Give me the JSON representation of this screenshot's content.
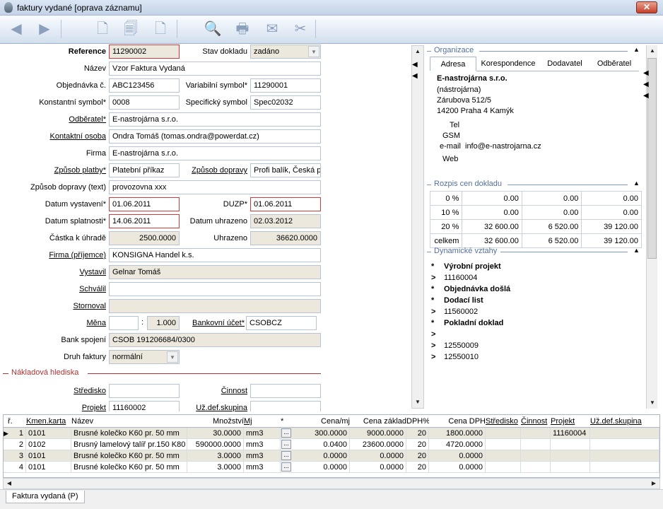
{
  "window": {
    "title": "faktury vydané [oprava záznamu]",
    "close_label": "✕"
  },
  "form": {
    "reference_label": "Reference",
    "reference_value": "11290002",
    "stav_label": "Stav dokladu",
    "stav_value": "zadáno",
    "nazev_label": "Název",
    "nazev_value": "Vzor Faktura Vydaná",
    "objednavka_label": "Objednávka č.",
    "objednavka_value": "ABC123456",
    "varsym_label": "Variabilní symbol*",
    "varsym_value": "11290001",
    "konstsym_label": "Konstantní symbol*",
    "konstsym_value": "0008",
    "specsym_label": "Specifický symbol",
    "specsym_value": "Spec02032",
    "odberatel_label": "Odběratel*",
    "odberatel_value": "E-nastrojárna s.r.o.",
    "kontakt_label": "Kontaktní osoba",
    "kontakt_value": "Ondra Tomáš (tomas.ondra@powerdat.cz)",
    "firma_label": "Firma",
    "firma_value": "E-nastrojárna s.r.o.",
    "platba_label": "Způsob platby*",
    "platba_value": "Platební příkaz",
    "doprava_label": "Způsob dopravy",
    "doprava_value": "Profi balík, Česká p",
    "dopravatext_label": "Způsob dopravy (text)",
    "dopravatext_value": "provozovna  xxx",
    "datvyst_label": "Datum vystavení*",
    "datvyst_value": "01.06.2011",
    "duzp_label": "DUZP*",
    "duzp_value": "01.06.2011",
    "datspl_label": "Datum splatnosti*",
    "datspl_value": "14.06.2011",
    "datuhr_label": "Datum uhrazeno",
    "datuhr_value": "02.03.2012",
    "castka_label": "Částka k úhradě",
    "castka_value": "2500.0000",
    "uhrazeno_label": "Uhrazeno",
    "uhrazeno_value": "36620.0000",
    "firmaprij_label": "Firma (příjemce)",
    "firmaprij_value": "KONSIGNA Handel k.s.",
    "vystavil_label": "Vystavil",
    "vystavil_value": "Gelnar Tomáš",
    "schvalil_label": "Schválil",
    "schvalil_value": "",
    "stornoval_label": "Stornoval",
    "stornoval_value": "",
    "mena_label": "Měna",
    "mena_value": "",
    "kurz_sep": ":",
    "kurz_value": "1.000",
    "ucet_label": "Bankovní účet*",
    "ucet_value": "CSOBCZ",
    "bankspoj_label": "Bank spojení",
    "bankspoj_value": "CSOB 191206684/0300",
    "druh_label": "Druh faktury",
    "druh_value": "normální",
    "nakl_section": "Nákladová hlediska",
    "stredisko_label": "Středisko",
    "stredisko_value": "",
    "cinnost_label": "Činnost",
    "cinnost_value": "",
    "projekt_label": "Projekt",
    "projekt_value": "11160002",
    "uzdef_label": "Už.def.skupina",
    "uzdef_value": ""
  },
  "org": {
    "section": "Organizace",
    "tabs": [
      "Adresa",
      "Korespondence",
      "Dodavatel",
      "Odběratel"
    ],
    "name": "E-nastrojárna s.r.o.",
    "short": "(nástrojárna)",
    "street": "Zárubova 512/5",
    "city": "14200 Praha 4 Kamýk",
    "tel_label": "Tel",
    "gsm_label": "GSM",
    "email_label": "e-mail",
    "email_value": "info@e-nastrojarna.cz",
    "web_label": "Web"
  },
  "prices": {
    "section": "Rozpis cen dokladu",
    "rows": [
      [
        "0 %",
        "0.00",
        "0.00",
        "0.00"
      ],
      [
        "10 %",
        "0.00",
        "0.00",
        "0.00"
      ],
      [
        "20 %",
        "32 600.00",
        "6 520.00",
        "39 120.00"
      ],
      [
        "celkem",
        "32 600.00",
        "6 520.00",
        "39 120.00"
      ]
    ]
  },
  "relations": {
    "section": "Dynamické vztahy",
    "items": [
      {
        "mark": "*",
        "text": "Výrobní projekt",
        "bold": true
      },
      {
        "mark": ">",
        "text": "11160004",
        "bold": false
      },
      {
        "mark": "*",
        "text": "Objednávka došlá",
        "bold": true
      },
      {
        "mark": "*",
        "text": "Dodací list",
        "bold": true
      },
      {
        "mark": ">",
        "text": "11560002",
        "bold": false
      },
      {
        "mark": "*",
        "text": "Pokladní doklad",
        "bold": true
      },
      {
        "mark": ">",
        "text": "",
        "bold": false
      },
      {
        "mark": ">",
        "text": "12550009",
        "bold": false
      },
      {
        "mark": ">",
        "text": "12550010",
        "bold": false
      }
    ]
  },
  "grid": {
    "headers": [
      "ř.",
      "Kmen.karta",
      "Název",
      "Množství",
      "Mj",
      "*",
      "Cena/mj",
      "Cena základ",
      "DPH%",
      "Cena DPH",
      "Středisko",
      "Činnost",
      "Projekt",
      "Už.def.skupina"
    ],
    "rows": [
      [
        "1",
        "0101",
        "Brusné kolečko K60 pr. 50 mm",
        "30.0000",
        "mm3",
        "...",
        "300.0000",
        "9000.0000",
        "20",
        "1800.0000",
        "",
        "",
        "11160004",
        ""
      ],
      [
        "2",
        "0102",
        "Brusný lamelový talíř pr.150  K80",
        "590000.0000",
        "mm3",
        "...",
        "0.0400",
        "23600.0000",
        "20",
        "4720.0000",
        "",
        "",
        "",
        ""
      ],
      [
        "3",
        "0101",
        "Brusné kolečko K60 pr. 50 mm",
        "3.0000",
        "mm3",
        "...",
        "0.0000",
        "0.0000",
        "20",
        "0.0000",
        "",
        "",
        "",
        ""
      ],
      [
        "4",
        "0101",
        "Brusné kolečko K60 pr. 50 mm",
        "3.0000",
        "mm3",
        "...",
        "0.0000",
        "0.0000",
        "20",
        "0.0000",
        "",
        "",
        "",
        ""
      ]
    ]
  },
  "status": {
    "sheet_tab": "Faktura vydaná (P)"
  }
}
